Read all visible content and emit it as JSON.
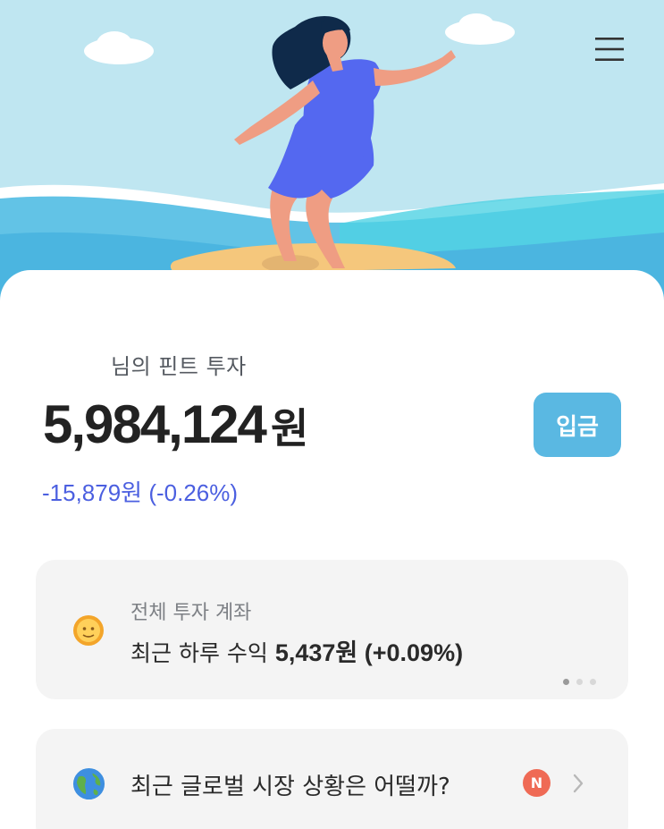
{
  "header": {
    "menu_icon": "hamburger-menu-icon",
    "illustration": "surfer-on-wave-illustration"
  },
  "account": {
    "owner_line": "님의 핀트 투자",
    "balance_amount": "5,984,124",
    "balance_unit": "원",
    "deposit_label": "입금",
    "change_text": "-15,879원 (-0.26%)"
  },
  "cards": {
    "total_account": {
      "icon": "sun-face-icon",
      "title": "전체 투자 계좌",
      "profit_label": "최근 하루 수익",
      "profit_value": "5,437원 (+0.09%)",
      "page_dots": 3,
      "active_dot": 1
    },
    "market_news": {
      "icon": "globe-icon",
      "text": "최근 글로벌 시장 상황은 어떨까?",
      "badge": "N"
    }
  },
  "colors": {
    "deposit_button": "#5ab8e2",
    "change_negative": "#4b5fe0",
    "new_badge": "#ef6a55",
    "sky": "#bfe6f1",
    "card_bg": "#f4f4f4"
  }
}
